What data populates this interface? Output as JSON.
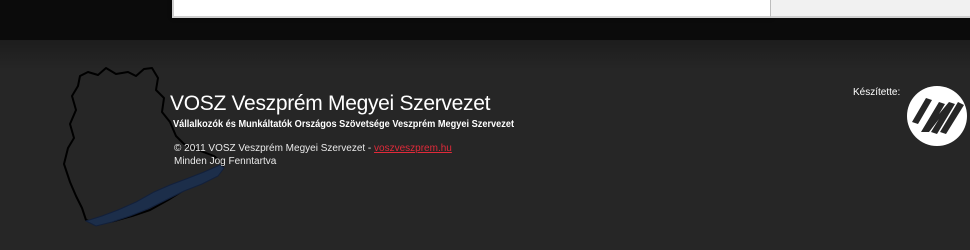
{
  "footer": {
    "title": "VOSZ Veszprém Megyei Szervezet",
    "subtitle": "Vállalkozók és Munkáltatók Országos Szövetsége Veszprém Megyei Szervezet",
    "copyright_prefix": "© 2011 VOSZ Veszprém Megyei Szervezet - ",
    "link_text": "voszveszprem.hu",
    "rights": "Minden Jog Fenntartva",
    "credit_label": "Készítette:"
  },
  "colors": {
    "background": "#262626",
    "top_band": "#0b0b0b",
    "link": "#e02a3a",
    "lake": "#1c2e4a"
  },
  "icons": {
    "map": "veszprem-county-map-icon",
    "logo": "maker-logo-icon"
  }
}
